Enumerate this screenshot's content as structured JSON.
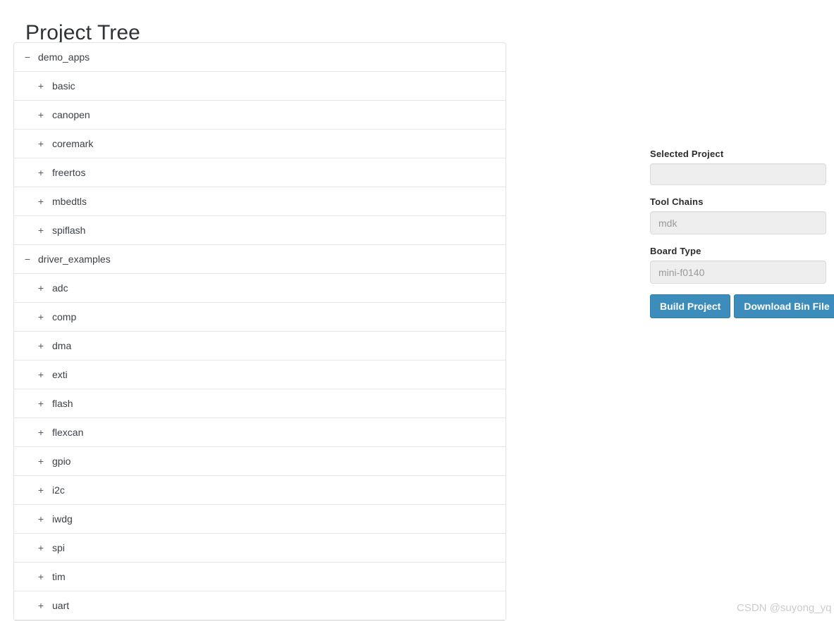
{
  "page": {
    "title": "Project Tree"
  },
  "tree": {
    "expand_icon": "+",
    "collapse_icon": "−",
    "nodes": [
      {
        "label": "demo_apps",
        "depth": 0,
        "state": "expanded",
        "icon": "collapse-icon"
      },
      {
        "label": "basic",
        "depth": 1,
        "state": "collapsed",
        "icon": "expand-icon"
      },
      {
        "label": "canopen",
        "depth": 1,
        "state": "collapsed",
        "icon": "expand-icon"
      },
      {
        "label": "coremark",
        "depth": 1,
        "state": "collapsed",
        "icon": "expand-icon"
      },
      {
        "label": "freertos",
        "depth": 1,
        "state": "collapsed",
        "icon": "expand-icon"
      },
      {
        "label": "mbedtls",
        "depth": 1,
        "state": "collapsed",
        "icon": "expand-icon"
      },
      {
        "label": "spiflash",
        "depth": 1,
        "state": "collapsed",
        "icon": "expand-icon"
      },
      {
        "label": "driver_examples",
        "depth": 0,
        "state": "expanded",
        "icon": "collapse-icon"
      },
      {
        "label": "adc",
        "depth": 1,
        "state": "collapsed",
        "icon": "expand-icon"
      },
      {
        "label": "comp",
        "depth": 1,
        "state": "collapsed",
        "icon": "expand-icon"
      },
      {
        "label": "dma",
        "depth": 1,
        "state": "collapsed",
        "icon": "expand-icon"
      },
      {
        "label": "exti",
        "depth": 1,
        "state": "collapsed",
        "icon": "expand-icon"
      },
      {
        "label": "flash",
        "depth": 1,
        "state": "collapsed",
        "icon": "expand-icon"
      },
      {
        "label": "flexcan",
        "depth": 1,
        "state": "collapsed",
        "icon": "expand-icon"
      },
      {
        "label": "gpio",
        "depth": 1,
        "state": "collapsed",
        "icon": "expand-icon"
      },
      {
        "label": "i2c",
        "depth": 1,
        "state": "collapsed",
        "icon": "expand-icon"
      },
      {
        "label": "iwdg",
        "depth": 1,
        "state": "collapsed",
        "icon": "expand-icon"
      },
      {
        "label": "spi",
        "depth": 1,
        "state": "collapsed",
        "icon": "expand-icon"
      },
      {
        "label": "tim",
        "depth": 1,
        "state": "collapsed",
        "icon": "expand-icon"
      },
      {
        "label": "uart",
        "depth": 1,
        "state": "collapsed",
        "icon": "expand-icon"
      }
    ]
  },
  "form": {
    "selected_project": {
      "label": "Selected Project",
      "value": "",
      "placeholder": ""
    },
    "tool_chains": {
      "label": "Tool Chains",
      "value": "",
      "placeholder": "mdk"
    },
    "board_type": {
      "label": "Board Type",
      "value": "",
      "placeholder": "mini-f0140"
    },
    "buttons": {
      "build": "Build Project",
      "download": "Download Bin File"
    }
  },
  "watermark": {
    "text": "CSDN @suyong_yq"
  },
  "colors": {
    "button_primary": "#3c8dbc",
    "button_border": "#357ca5",
    "input_background": "#eeeeee",
    "input_border": "#dcdcdc",
    "row_border": "#e6e6e6",
    "text_primary": "#3a4148",
    "watermark": "#c9ccd1"
  }
}
